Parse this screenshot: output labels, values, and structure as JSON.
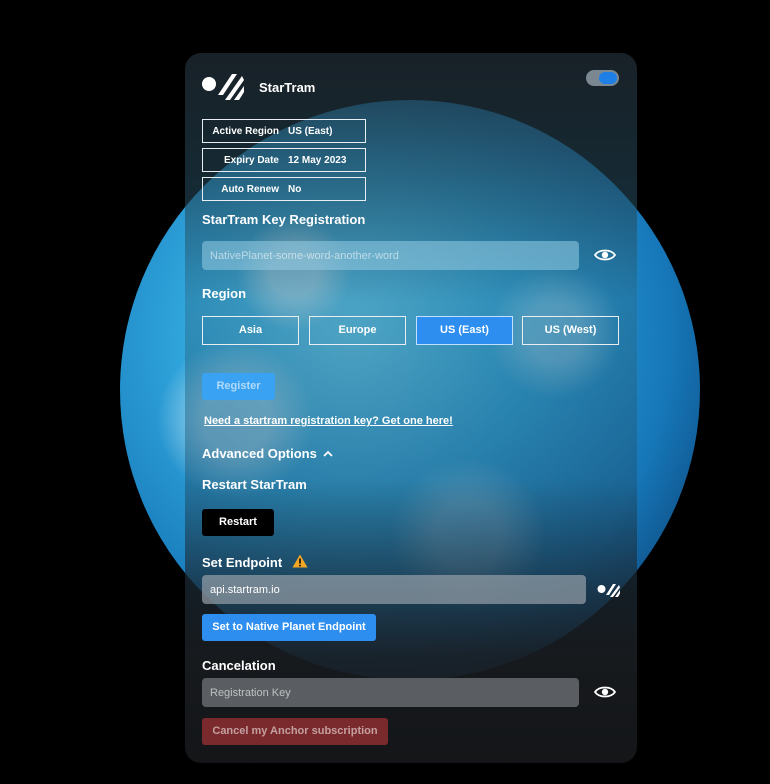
{
  "app": {
    "title": "StarTram"
  },
  "toggle": {
    "on": true
  },
  "info": [
    {
      "label": "Active Region",
      "value": "US (East)"
    },
    {
      "label": "Expiry Date",
      "value": "12 May 2023"
    },
    {
      "label": "Auto Renew",
      "value": "No"
    }
  ],
  "registration": {
    "title": "StarTram Key Registration",
    "key_value": "NativePlanet-some-word-another-word",
    "eye_icon": "eye-icon"
  },
  "region": {
    "title": "Region",
    "options": [
      "Asia",
      "Europe",
      "US (East)",
      "US (West)"
    ],
    "selected": "US (East)"
  },
  "register_button": "Register",
  "get_key_link": "Need a startram registration key? Get one here!",
  "advanced": {
    "label": "Advanced Options",
    "restart_title": "Restart StarTram",
    "restart_button": "Restart",
    "endpoint_title": "Set Endpoint",
    "endpoint_value": "api.startram.io",
    "set_endpoint_button": "Set to Native Planet Endpoint"
  },
  "cancelation": {
    "title": "Cancelation",
    "key_placeholder": "Registration Key",
    "cancel_button": "Cancel my Anchor subscription"
  },
  "colors": {
    "accent": "#2d8ef0",
    "danger": "#a23a3c",
    "warning": "#f5a623"
  }
}
